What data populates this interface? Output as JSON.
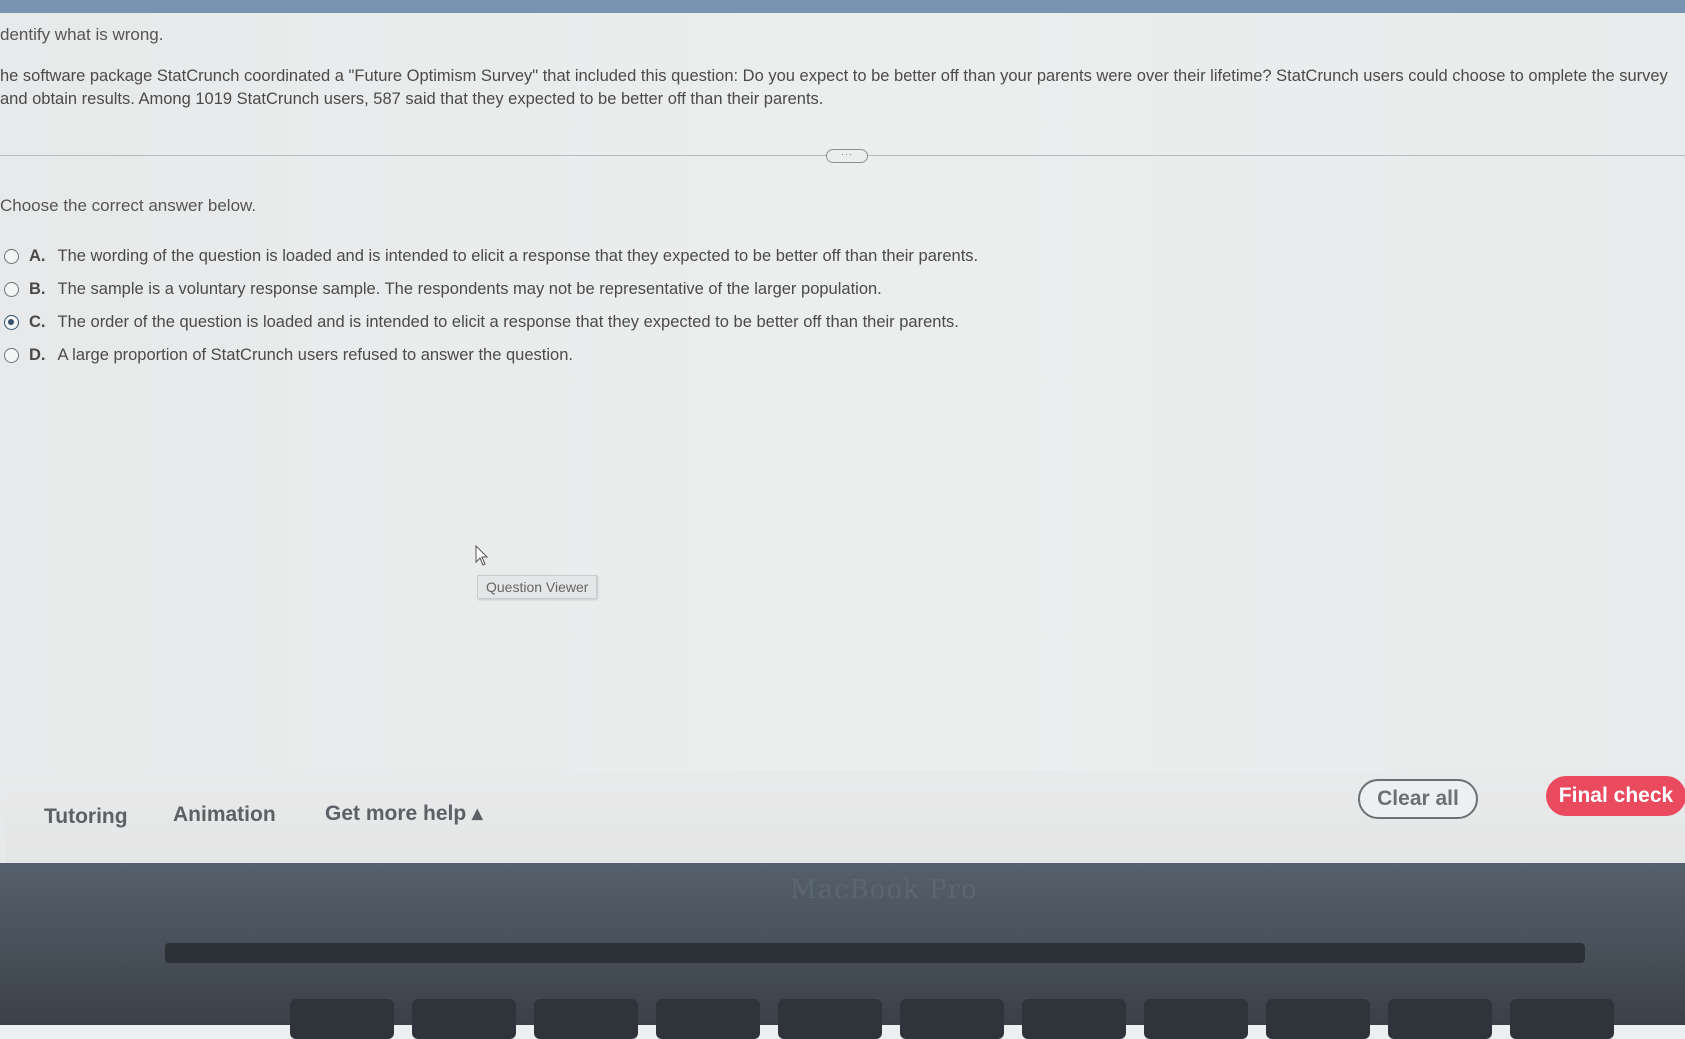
{
  "question": {
    "instruction": "dentify what is wrong.",
    "problem_text": "he software package StatCrunch coordinated a \"Future Optimism Survey\" that included this question: Do you expect to be better off than your parents were over their lifetime? StatCrunch users could choose to omplete the survey and obtain results. Among 1019 StatCrunch users, 587 said that they expected to be better off than their parents.",
    "divider_handle": "···",
    "prompt": "Choose the correct answer below."
  },
  "options": [
    {
      "letter": "A.",
      "text": "The wording of the question is loaded and is intended to elicit a response that they expected to be better off than their parents.",
      "selected": false
    },
    {
      "letter": "B.",
      "text": "The sample is a voluntary response sample. The respondents may not be representative of the larger population.",
      "selected": false
    },
    {
      "letter": "C.",
      "text": "The order of the question is loaded and is intended to elicit a response that they expected to be better off than their parents.",
      "selected": true
    },
    {
      "letter": "D.",
      "text": "A large proportion of StatCrunch users refused to answer the question.",
      "selected": false
    }
  ],
  "tooltip": "Question Viewer",
  "footer": {
    "tutoring": "Tutoring",
    "animation": "Animation",
    "get_more_help": "Get more help ▴",
    "clear_all": "Clear all",
    "final_check": "Final check"
  },
  "device": {
    "label": "MacBook Pro"
  },
  "colors": {
    "final_check_bg": "#e94a5e",
    "selected_radio": "#35506e"
  }
}
